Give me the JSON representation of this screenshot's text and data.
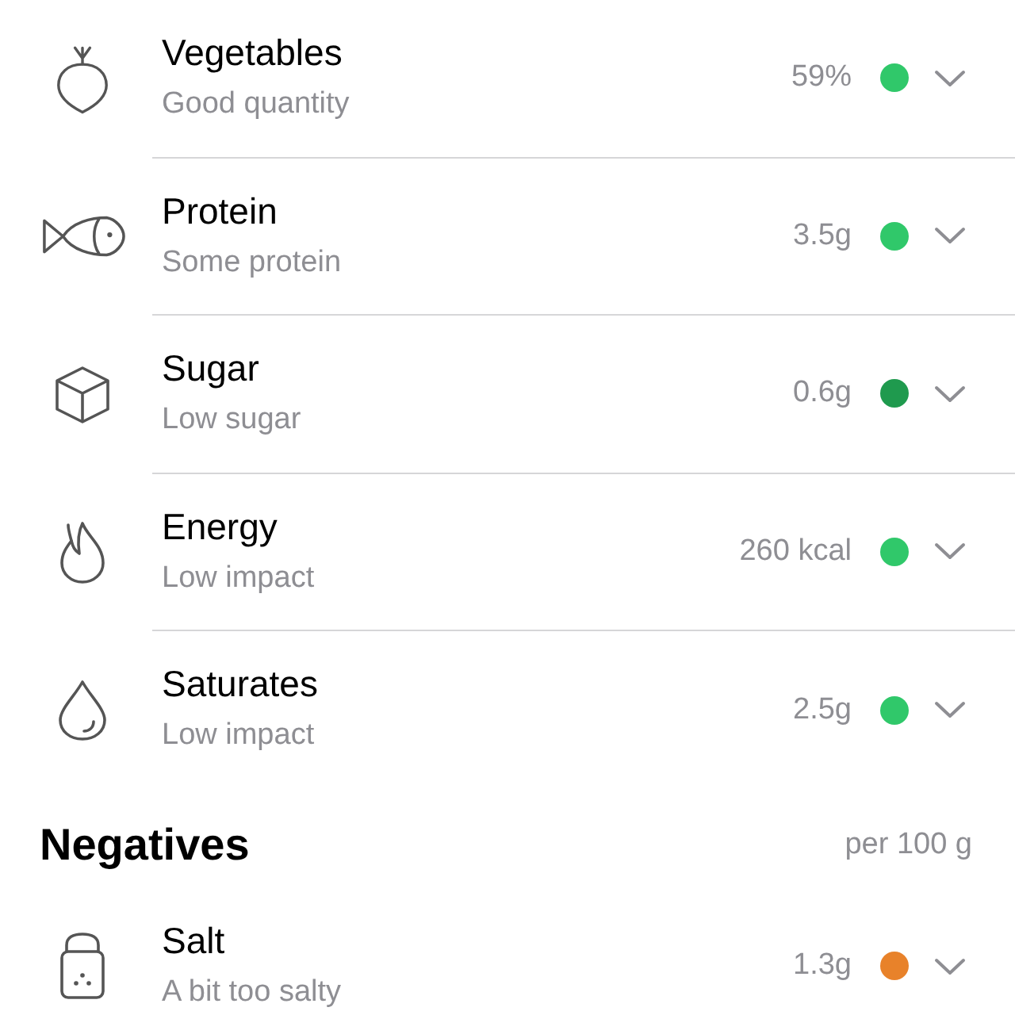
{
  "nutrients": [
    {
      "kind": "vegetables",
      "name": "Vegetables",
      "assessment": "Good quantity",
      "amount": "59%",
      "color": "#30c86a",
      "expanded": false
    },
    {
      "kind": "protein",
      "name": "Protein",
      "assessment": "Some protein",
      "amount": "3.5g",
      "color": "#30c86a",
      "expanded": false
    },
    {
      "kind": "sugar",
      "name": "Sugar",
      "assessment": "Low sugar",
      "amount": "0.6g",
      "color": "#1f9a4e",
      "expanded": false
    },
    {
      "kind": "energy",
      "name": "Energy",
      "assessment": "Low impact",
      "amount": "260 kcal",
      "color": "#30c86a",
      "expanded": false
    },
    {
      "kind": "saturates",
      "name": "Saturates",
      "assessment": "Low impact",
      "amount": "2.5g",
      "color": "#30c86a",
      "expanded": false
    }
  ],
  "negatives": {
    "title": "Negatives",
    "unit": "per 100 g",
    "items": [
      {
        "kind": "salt",
        "name": "Salt",
        "assessment": "A bit too salty",
        "amount": "1.3g",
        "color": "#e8822a",
        "expanded": false
      }
    ]
  }
}
